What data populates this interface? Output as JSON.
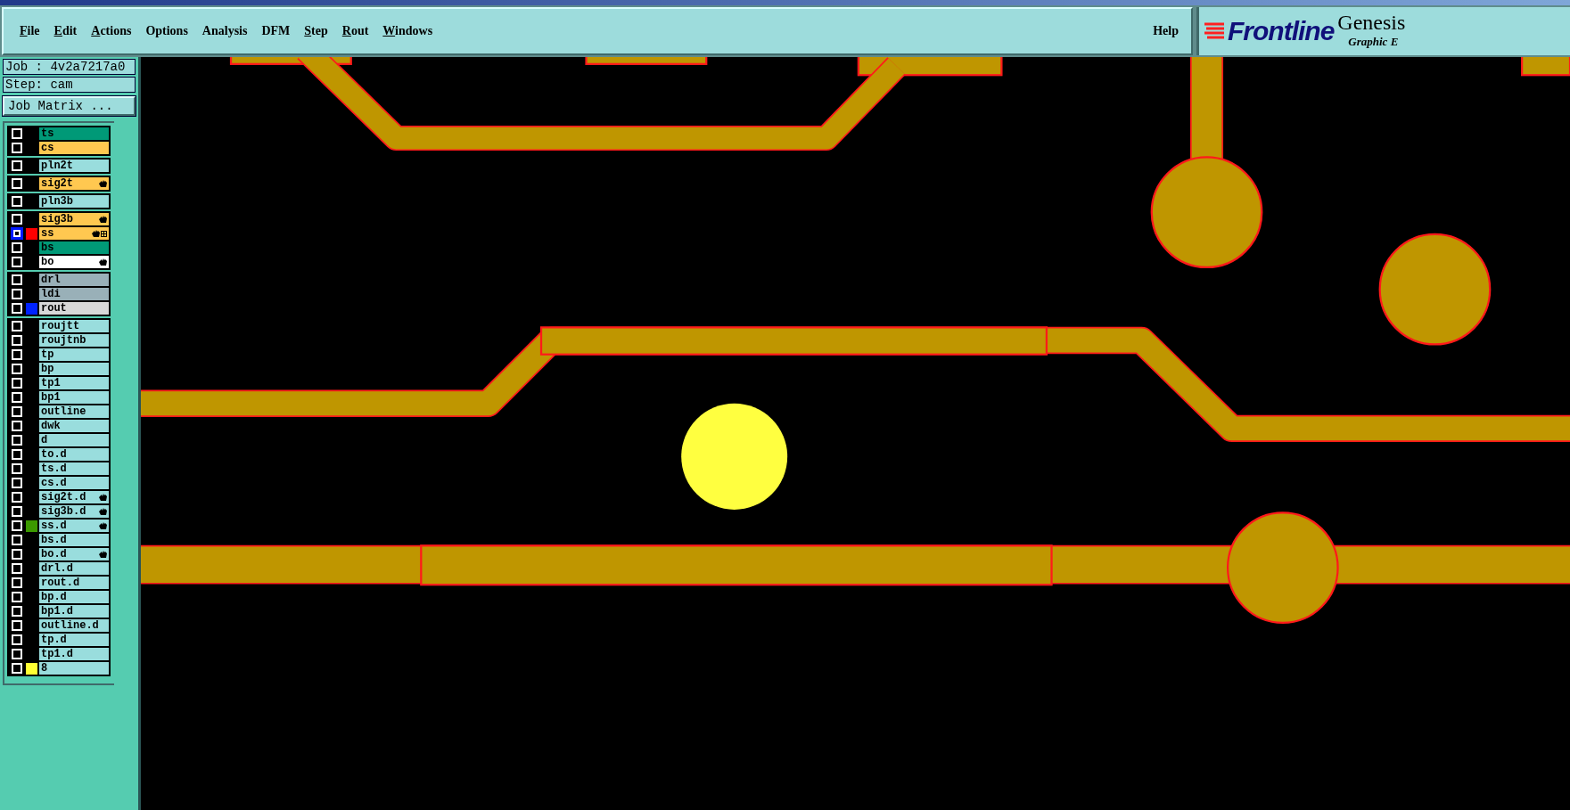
{
  "menu": [
    {
      "label": "File",
      "underlined": true
    },
    {
      "label": "Edit",
      "underlined": true
    },
    {
      "label": "Actions",
      "underlined": true
    },
    {
      "label": "Options",
      "underlined": false
    },
    {
      "label": "Analysis",
      "underlined": false
    },
    {
      "label": "DFM",
      "underlined": false
    },
    {
      "label": "Step",
      "underlined": true
    },
    {
      "label": "Rout",
      "underlined": true
    },
    {
      "label": "Windows",
      "underlined": true
    }
  ],
  "help": "Help",
  "logo": {
    "brand": "Frontline",
    "product": "Genesis",
    "subtitle": "Graphic E"
  },
  "job": "Job : 4v2a7217a0",
  "step": "Step: cam",
  "job_matrix_button": "Job Matrix ...",
  "layer_groups": [
    [
      {
        "name": "ts",
        "kind": "solder_mask",
        "selected": false,
        "affected": false,
        "grid_marker": false
      },
      {
        "name": "cs",
        "kind": "signal",
        "selected": false,
        "affected": false,
        "grid_marker": false
      }
    ],
    [
      {
        "name": "pln2t",
        "kind": "power_ground",
        "selected": false,
        "affected": false,
        "grid_marker": false
      }
    ],
    [
      {
        "name": "sig2t",
        "kind": "signal",
        "selected": false,
        "affected": true,
        "grid_marker": false
      }
    ],
    [
      {
        "name": "pln3b",
        "kind": "power_ground",
        "selected": false,
        "affected": false,
        "grid_marker": false
      }
    ],
    [
      {
        "name": "sig3b",
        "kind": "signal",
        "selected": false,
        "affected": true,
        "grid_marker": false
      },
      {
        "name": "ss",
        "kind": "signal",
        "selected": true,
        "affected": true,
        "grid_marker": true,
        "color": "#ff0000"
      },
      {
        "name": "bs",
        "kind": "solder_mask",
        "selected": false,
        "affected": false,
        "grid_marker": false
      },
      {
        "name": "bo",
        "kind": "silk_screen",
        "selected": false,
        "affected": true,
        "grid_marker": false
      }
    ],
    [
      {
        "name": "drl",
        "kind": "drill",
        "selected": false,
        "affected": false,
        "grid_marker": false
      },
      {
        "name": "ldi",
        "kind": "drill",
        "selected": false,
        "affected": false,
        "grid_marker": false
      },
      {
        "name": "rout",
        "kind": "rout",
        "selected": false,
        "affected": false,
        "grid_marker": false,
        "color": "#0022ff"
      }
    ],
    [
      {
        "name": "roujtt",
        "kind": "misc",
        "selected": false,
        "affected": false,
        "grid_marker": false
      },
      {
        "name": "roujtnb",
        "kind": "misc",
        "selected": false,
        "affected": false,
        "grid_marker": false
      },
      {
        "name": "tp",
        "kind": "misc",
        "selected": false,
        "affected": false,
        "grid_marker": false
      },
      {
        "name": "bp",
        "kind": "misc",
        "selected": false,
        "affected": false,
        "grid_marker": false
      },
      {
        "name": "tp1",
        "kind": "misc",
        "selected": false,
        "affected": false,
        "grid_marker": false
      },
      {
        "name": "bp1",
        "kind": "misc",
        "selected": false,
        "affected": false,
        "grid_marker": false
      },
      {
        "name": "outline",
        "kind": "misc",
        "selected": false,
        "affected": false,
        "grid_marker": false
      },
      {
        "name": "dwk",
        "kind": "misc",
        "selected": false,
        "affected": false,
        "grid_marker": false
      },
      {
        "name": "d",
        "kind": "misc",
        "selected": false,
        "affected": false,
        "grid_marker": false
      },
      {
        "name": "to.d",
        "kind": "misc",
        "selected": false,
        "affected": false,
        "grid_marker": false
      },
      {
        "name": "ts.d",
        "kind": "misc",
        "selected": false,
        "affected": false,
        "grid_marker": false
      },
      {
        "name": "cs.d",
        "kind": "misc",
        "selected": false,
        "affected": false,
        "grid_marker": false
      },
      {
        "name": "sig2t.d",
        "kind": "misc",
        "selected": false,
        "affected": true,
        "grid_marker": false
      },
      {
        "name": "sig3b.d",
        "kind": "misc",
        "selected": false,
        "affected": true,
        "grid_marker": false
      },
      {
        "name": "ss.d",
        "kind": "misc",
        "selected": false,
        "affected": true,
        "grid_marker": false,
        "color": "#3c9a00"
      },
      {
        "name": "bs.d",
        "kind": "misc",
        "selected": false,
        "affected": false,
        "grid_marker": false
      },
      {
        "name": "bo.d",
        "kind": "misc",
        "selected": false,
        "affected": true,
        "grid_marker": false
      },
      {
        "name": "drl.d",
        "kind": "misc",
        "selected": false,
        "affected": false,
        "grid_marker": false
      },
      {
        "name": "rout.d",
        "kind": "misc",
        "selected": false,
        "affected": false,
        "grid_marker": false
      },
      {
        "name": "bp.d",
        "kind": "misc",
        "selected": false,
        "affected": false,
        "grid_marker": false
      },
      {
        "name": "bp1.d",
        "kind": "misc",
        "selected": false,
        "affected": false,
        "grid_marker": false
      },
      {
        "name": "outline.d",
        "kind": "misc",
        "selected": false,
        "affected": false,
        "grid_marker": false
      },
      {
        "name": "tp.d",
        "kind": "misc",
        "selected": false,
        "affected": false,
        "grid_marker": false
      },
      {
        "name": "tp1.d",
        "kind": "misc",
        "selected": false,
        "affected": false,
        "grid_marker": false
      },
      {
        "name": "8",
        "kind": "misc",
        "selected": false,
        "affected": false,
        "grid_marker": false,
        "color": "#ffff33"
      }
    ]
  ]
}
